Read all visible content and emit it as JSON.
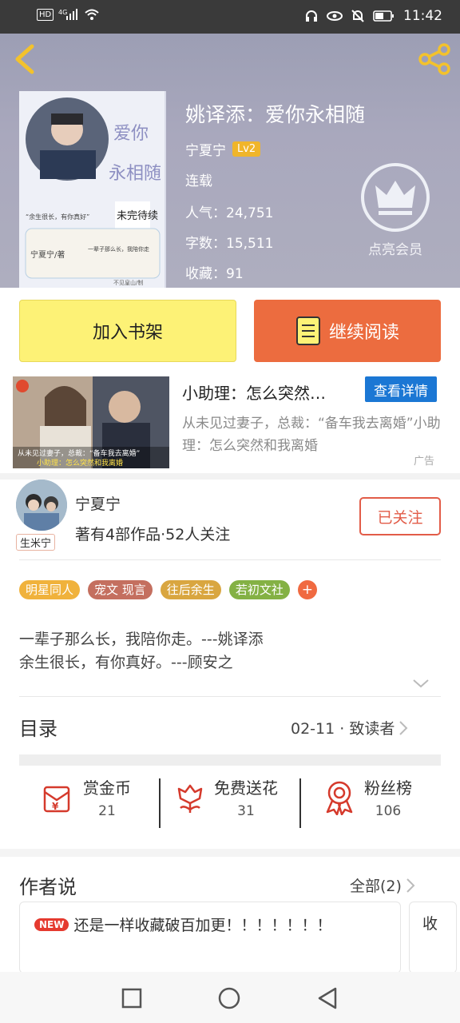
{
  "status": {
    "left_icons": "HD 4G",
    "time": "11:42"
  },
  "book": {
    "title": "姚译添：爱你永相随",
    "author": "宁夏宁",
    "level": "Lv2",
    "status": "连载",
    "popularity": "人气：24,751",
    "word_count": "字数：15,511",
    "favorites": "收藏：91",
    "member_label": "点亮会员"
  },
  "cover": {
    "line1": "爱你",
    "line2": "永相随",
    "badge": "未完待续",
    "quote1": "“余生很长，有你真好”",
    "quote2": "一辈子那么长，我陪你走",
    "author_note": "宁夏宁/著",
    "footer": "不见皇山/制"
  },
  "actions": {
    "add_shelf": "加入书架",
    "continue_read": "继续阅读"
  },
  "ad": {
    "title": "小助理：怎么突然…",
    "button": "查看详情",
    "desc": "从未见过妻子，总裁：“备车我去离婚”小助理：怎么突然和我离婚",
    "tag": "广告",
    "img_caption1": "从未见过妻子，总裁：“备车我去离婚”",
    "img_caption2": "小助理：怎么突然和我离婚"
  },
  "author_box": {
    "name": "宁夏宁",
    "stats": "著有4部作品·52人关注",
    "follow": "已关注",
    "avatar_tag": "生米宁"
  },
  "tags": [
    "明星同人",
    "宠文 现言",
    "往后余生",
    "若初文社"
  ],
  "tag_colors": [
    "#f0b23c",
    "#c46f5f",
    "#d9a640",
    "#84b144"
  ],
  "intro": [
    "一辈子那么长，我陪你走。---姚译添",
    "余生很长，有你真好。---顾安之"
  ],
  "toc": {
    "label": "目录",
    "latest": "02-11 · 致读者"
  },
  "stats": [
    {
      "label": "赏金币",
      "value": "21"
    },
    {
      "label": "免费送花",
      "value": "31"
    },
    {
      "label": "粉丝榜",
      "value": "106"
    }
  ],
  "author_says": {
    "label": "作者说",
    "all": "全部(2)",
    "badge": "NEW",
    "text": "还是一样收藏破百加更！！！！！！！",
    "next_text": "收"
  }
}
